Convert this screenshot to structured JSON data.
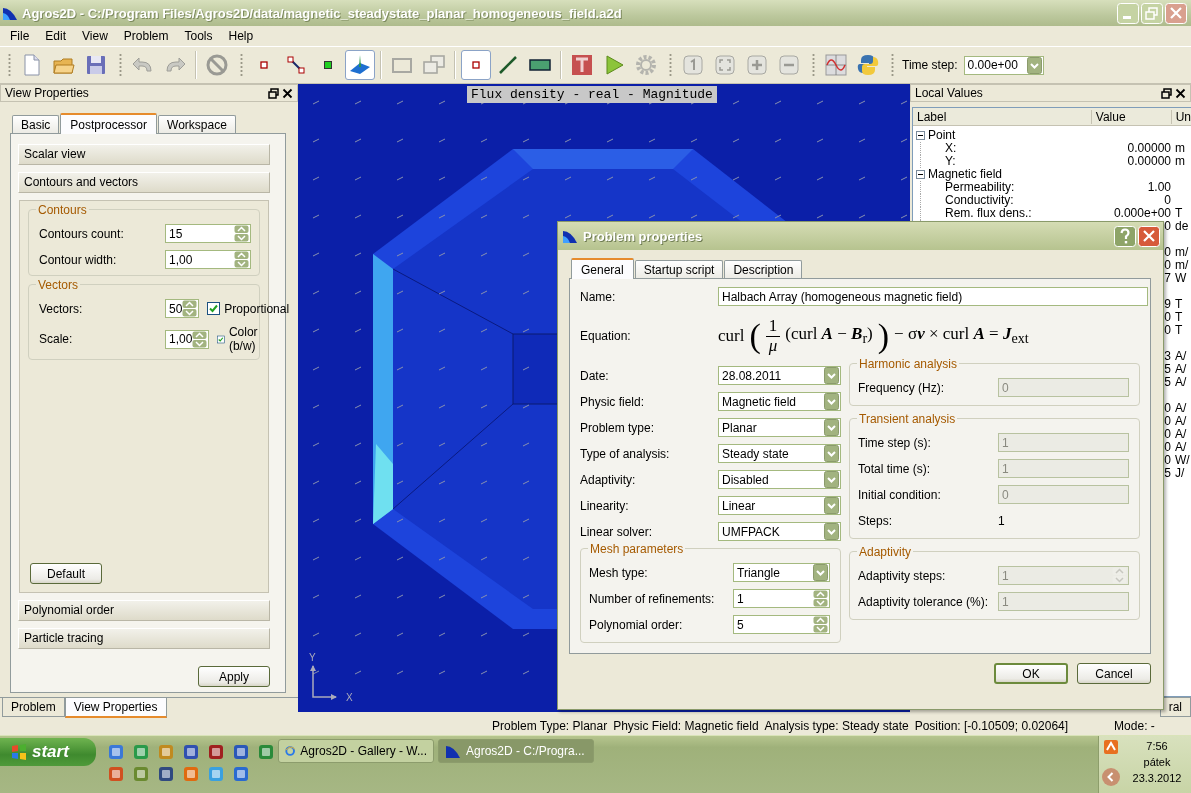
{
  "window": {
    "title": "Agros2D - C:/Program Files/Agros2D/data/magnetic_steadystate_planar_homogeneous_field.a2d"
  },
  "menu": [
    "File",
    "Edit",
    "View",
    "Problem",
    "Tools",
    "Help"
  ],
  "toolbar": {
    "groups": [
      [
        [
          {
            "kind": "new",
            "selected": false
          },
          {
            "kind": "open",
            "selected": false
          },
          {
            "kind": "save",
            "selected": false
          }
        ]
      ],
      [
        [
          {
            "kind": "undo",
            "selected": false
          },
          {
            "kind": "redo",
            "selected": false
          }
        ],
        [
          {
            "kind": "stop",
            "selected": false
          }
        ]
      ],
      [
        [
          {
            "kind": "node",
            "selected": false
          },
          {
            "kind": "edge",
            "selected": false
          },
          {
            "kind": "label",
            "selected": false
          },
          {
            "kind": "mesh3d",
            "selected": true
          }
        ],
        [
          {
            "kind": "rect",
            "selected": false
          },
          {
            "kind": "rects",
            "selected": false
          }
        ],
        [
          {
            "kind": "point",
            "selected": true
          },
          {
            "kind": "line",
            "selected": false
          },
          {
            "kind": "area",
            "selected": false
          }
        ],
        [
          {
            "kind": "text",
            "selected": false
          },
          {
            "kind": "run",
            "selected": false
          },
          {
            "kind": "gear",
            "selected": false
          }
        ]
      ],
      [
        [
          {
            "kind": "zoom1",
            "selected": false
          },
          {
            "kind": "zoombest",
            "selected": false
          },
          {
            "kind": "zoomin",
            "selected": false
          },
          {
            "kind": "zoomout",
            "selected": false
          }
        ]
      ],
      [
        [
          {
            "kind": "chart",
            "selected": false
          },
          {
            "kind": "python",
            "selected": false
          }
        ]
      ]
    ],
    "time_step": {
      "label": "Time step:",
      "value": "0.00e+00"
    }
  },
  "view_properties": {
    "title": "View Properties",
    "tabs": [
      {
        "label": "Basic",
        "selected": false
      },
      {
        "label": "Postprocessor",
        "selected": true
      },
      {
        "label": "Workspace",
        "selected": false
      }
    ],
    "sections": [
      {
        "label": "Scalar view"
      },
      {
        "label": "Contours and vectors",
        "groups": [
          {
            "title": "Contours",
            "rows": [
              {
                "label": "Contours count:",
                "value": "15"
              },
              {
                "label": "Contour width:",
                "value": "1,00"
              }
            ]
          },
          {
            "title": "Vectors",
            "rows": [
              {
                "label": "Vectors:",
                "value": "50",
                "checkbox": {
                  "label": "Proportional",
                  "checked": true
                }
              },
              {
                "label": "Scale:",
                "value": "1,00",
                "checkbox": {
                  "label": "Color (b/w)",
                  "checked": true
                }
              }
            ]
          }
        ],
        "default_button": "Default"
      },
      {
        "label": "Polynomial order"
      },
      {
        "label": "Particle tracing"
      }
    ],
    "apply_button": "Apply"
  },
  "dock_tabs": [
    {
      "label": "Problem",
      "selected": false
    },
    {
      "label": "View Properties",
      "selected": true
    }
  ],
  "plot": {
    "title": "Flux density - real - Magnitude",
    "axis_x": "X",
    "axis_y": "Y"
  },
  "local_values": {
    "title": "Local Values",
    "columns": [
      "Label",
      "Value",
      "Un"
    ],
    "tree": [
      {
        "label": "Point",
        "expanded": true,
        "children": [
          {
            "kind": "value",
            "label": "X:",
            "value": "0.00000",
            "unit": "m"
          },
          {
            "kind": "value",
            "label": "Y:",
            "value": "0.00000",
            "unit": "m"
          }
        ]
      },
      {
        "label": "Magnetic field",
        "expanded": true,
        "children": [
          {
            "kind": "value",
            "label": "Permeability:",
            "value": "1.00"
          },
          {
            "kind": "value",
            "label": "Conductivity:",
            "value": "0"
          },
          {
            "kind": "value",
            "label": "Rem. flux dens.:",
            "value": "0.000e+00",
            "unit": "T"
          },
          {
            "kind": "value",
            "value": "0",
            "unit": "de"
          },
          {
            "kind": "spacer"
          },
          {
            "kind": "value",
            "value": "0",
            "unit": "m/"
          },
          {
            "kind": "value",
            "value": "0",
            "unit": "m/"
          },
          {
            "kind": "value",
            "value": "7",
            "unit": "W"
          },
          {
            "kind": "spacer"
          },
          {
            "kind": "value",
            "value": "9",
            "unit": "T"
          },
          {
            "kind": "value",
            "value": "0",
            "unit": "T"
          },
          {
            "kind": "value",
            "value": "0",
            "unit": "T"
          },
          {
            "kind": "spacer"
          },
          {
            "kind": "value",
            "value": "3",
            "unit": "A/"
          },
          {
            "kind": "value",
            "value": "5",
            "unit": "A/"
          },
          {
            "kind": "value",
            "value": "5",
            "unit": "A/"
          },
          {
            "kind": "spacer"
          },
          {
            "kind": "value",
            "value": "0",
            "unit": "A/"
          },
          {
            "kind": "value",
            "value": "0",
            "unit": "A/"
          },
          {
            "kind": "value",
            "value": "0",
            "unit": "A/"
          },
          {
            "kind": "value",
            "value": "0",
            "unit": "A/"
          },
          {
            "kind": "value",
            "value": "0",
            "unit": "W/"
          },
          {
            "kind": "value",
            "value": "5",
            "unit": "J/"
          }
        ]
      }
    ],
    "tab": "ral"
  },
  "status_bar": [
    "Problem Type: Planar",
    "Physic Field: Magnetic field",
    "Analysis type: Steady state",
    "Position: [-0.10509;  0.02064]",
    "Mode: -"
  ],
  "taskbar": {
    "start": "start",
    "tasks": [
      {
        "label": "Agros2D - Gallery - W...",
        "selected": false
      },
      {
        "label": "Agros2D - C:/Progra...",
        "selected": true
      }
    ],
    "clock": {
      "time": "7:56",
      "day": "pátek",
      "date": "23.3.2012"
    }
  },
  "dialog": {
    "title": "Problem properties",
    "tabs": [
      {
        "label": "General",
        "selected": true
      },
      {
        "label": "Startup script",
        "selected": false
      },
      {
        "label": "Description",
        "selected": false
      }
    ],
    "name": {
      "label": "Name:",
      "value": "Halbach Array (homogeneous magnetic field)"
    },
    "equation": {
      "label": "Equation:",
      "lead": "curl",
      "open": "(",
      "numerator": "1",
      "denominator": "μ",
      "inner": "(curl **A** − **B**$_{r}$)",
      "close": ")",
      "tail": "− σ**v** × curl **A** = **J**$_{ext}$"
    },
    "fields": [
      {
        "label": "Date:",
        "value": "28.08.2011",
        "kind": "combo"
      },
      {
        "label": "Physic field:",
        "value": "Magnetic field",
        "kind": "combo"
      },
      {
        "label": "Problem type:",
        "value": "Planar",
        "kind": "combo"
      },
      {
        "label": "Type of analysis:",
        "value": "Steady state",
        "kind": "combo"
      },
      {
        "label": "Adaptivity:",
        "value": "Disabled",
        "kind": "combo"
      },
      {
        "label": "Linearity:",
        "value": "Linear",
        "kind": "combo"
      },
      {
        "label": "Linear solver:",
        "value": "UMFPACK",
        "kind": "combo"
      }
    ],
    "mesh": {
      "title": "Mesh parameters",
      "rows": [
        {
          "label": "Mesh type:",
          "value": "Triangle",
          "kind": "combo",
          "disabled": false
        },
        {
          "label": "Number of refinements:",
          "value": "1",
          "kind": "spin",
          "disabled": false
        },
        {
          "label": "Polynomial order:",
          "value": "5",
          "kind": "spin",
          "disabled": false
        }
      ]
    },
    "groups": [
      {
        "title": "Harmonic analysis",
        "rows": [
          {
            "label": "Frequency (Hz):",
            "value": "0",
            "kind": "text",
            "disabled": true
          }
        ]
      },
      {
        "title": "Transient analysis",
        "rows": [
          {
            "label": "Time step (s):",
            "value": "1",
            "kind": "text",
            "disabled": true
          },
          {
            "label": "Total time (s):",
            "value": "1",
            "kind": "text",
            "disabled": true
          },
          {
            "label": "Initial condition:",
            "value": "0",
            "kind": "text",
            "disabled": true
          },
          {
            "label": "Steps:",
            "value": "1",
            "kind": "plain",
            "disabled": false
          }
        ]
      },
      {
        "title": "Adaptivity",
        "rows": [
          {
            "label": "Adaptivity steps:",
            "value": "1",
            "kind": "spin",
            "disabled": true
          },
          {
            "label": "Adaptivity tolerance (%):",
            "value": "1",
            "kind": "text",
            "disabled": true
          }
        ]
      }
    ],
    "buttons": [
      {
        "label": "OK",
        "default": true
      },
      {
        "label": "Cancel",
        "default": false
      }
    ]
  }
}
